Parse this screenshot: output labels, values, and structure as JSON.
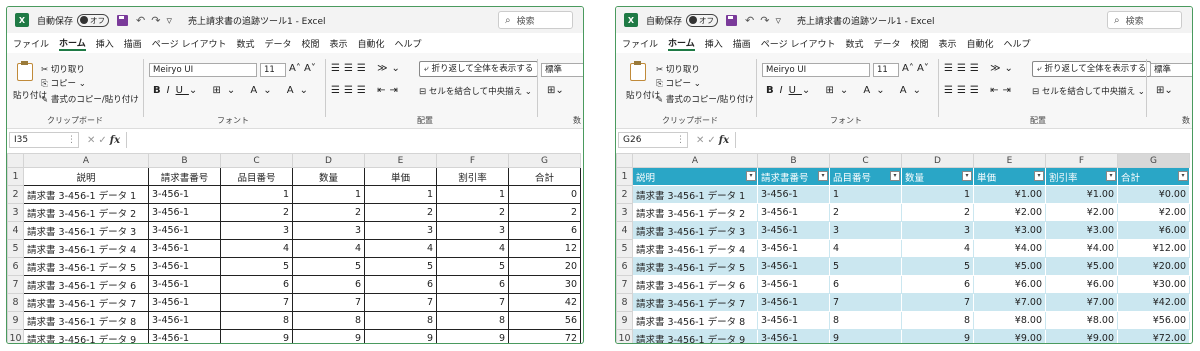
{
  "app": {
    "autosave_label": "自動保存",
    "autosave_state": "オフ",
    "doc_title": "売上請求書の追跡ツール1  -  Excel",
    "search_placeholder": "検索"
  },
  "menu": [
    "ファイル",
    "ホーム",
    "挿入",
    "描画",
    "ページ レイアウト",
    "数式",
    "データ",
    "校閲",
    "表示",
    "自動化",
    "ヘルプ"
  ],
  "ribbon": {
    "paste": "貼り付け",
    "cut": "切り取り",
    "copy": "コピー",
    "format_painter": "書式のコピー/貼り付け",
    "clipboard_group": "クリップボード",
    "font_name": "Meiryo UI",
    "font_size": "11",
    "font_group": "フォント",
    "wrap_text": "折り返して全体を表示する",
    "merge_center": "セルを結合して中央揃え",
    "alignment_group": "配置",
    "number_format": "標準",
    "number_group": "数"
  },
  "columns": [
    "A",
    "B",
    "C",
    "D",
    "E",
    "F",
    "G"
  ],
  "headers": [
    "説明",
    "請求書番号",
    "品目番号",
    "数量",
    "単価",
    "割引率",
    "合計"
  ],
  "left": {
    "name_box": "I35",
    "rows": [
      [
        "請求書 3-456-1 データ 1",
        "3-456-1",
        "1",
        "1",
        "1",
        "1",
        "0"
      ],
      [
        "請求書 3-456-1 データ 2",
        "3-456-1",
        "2",
        "2",
        "2",
        "2",
        "2"
      ],
      [
        "請求書 3-456-1 データ 3",
        "3-456-1",
        "3",
        "3",
        "3",
        "3",
        "6"
      ],
      [
        "請求書 3-456-1 データ 4",
        "3-456-1",
        "4",
        "4",
        "4",
        "4",
        "12"
      ],
      [
        "請求書 3-456-1 データ 5",
        "3-456-1",
        "5",
        "5",
        "5",
        "5",
        "20"
      ],
      [
        "請求書 3-456-1 データ 6",
        "3-456-1",
        "6",
        "6",
        "6",
        "6",
        "30"
      ],
      [
        "請求書 3-456-1 データ 7",
        "3-456-1",
        "7",
        "7",
        "7",
        "7",
        "42"
      ],
      [
        "請求書 3-456-1 データ 8",
        "3-456-1",
        "8",
        "8",
        "8",
        "8",
        "56"
      ],
      [
        "請求書 3-456-1 データ 9",
        "3-456-1",
        "9",
        "9",
        "9",
        "9",
        "72"
      ]
    ]
  },
  "right": {
    "name_box": "G26",
    "rows": [
      [
        "請求書 3-456-1 データ 1",
        "3-456-1",
        "1",
        "1",
        "¥1.00",
        "¥1.00",
        "¥0.00"
      ],
      [
        "請求書 3-456-1 データ 2",
        "3-456-1",
        "2",
        "2",
        "¥2.00",
        "¥2.00",
        "¥2.00"
      ],
      [
        "請求書 3-456-1 データ 3",
        "3-456-1",
        "3",
        "3",
        "¥3.00",
        "¥3.00",
        "¥6.00"
      ],
      [
        "請求書 3-456-1 データ 4",
        "3-456-1",
        "4",
        "4",
        "¥4.00",
        "¥4.00",
        "¥12.00"
      ],
      [
        "請求書 3-456-1 データ 5",
        "3-456-1",
        "5",
        "5",
        "¥5.00",
        "¥5.00",
        "¥20.00"
      ],
      [
        "請求書 3-456-1 データ 6",
        "3-456-1",
        "6",
        "6",
        "¥6.00",
        "¥6.00",
        "¥30.00"
      ],
      [
        "請求書 3-456-1 データ 7",
        "3-456-1",
        "7",
        "7",
        "¥7.00",
        "¥7.00",
        "¥42.00"
      ],
      [
        "請求書 3-456-1 データ 8",
        "3-456-1",
        "8",
        "8",
        "¥8.00",
        "¥8.00",
        "¥56.00"
      ],
      [
        "請求書 3-456-1 データ 9",
        "3-456-1",
        "9",
        "9",
        "¥9.00",
        "¥9.00",
        "¥72.00"
      ]
    ]
  },
  "colors": {
    "excel_green": "#1f7a45",
    "table_header": "#2aa6c6",
    "table_band": "#cbe7f0"
  }
}
